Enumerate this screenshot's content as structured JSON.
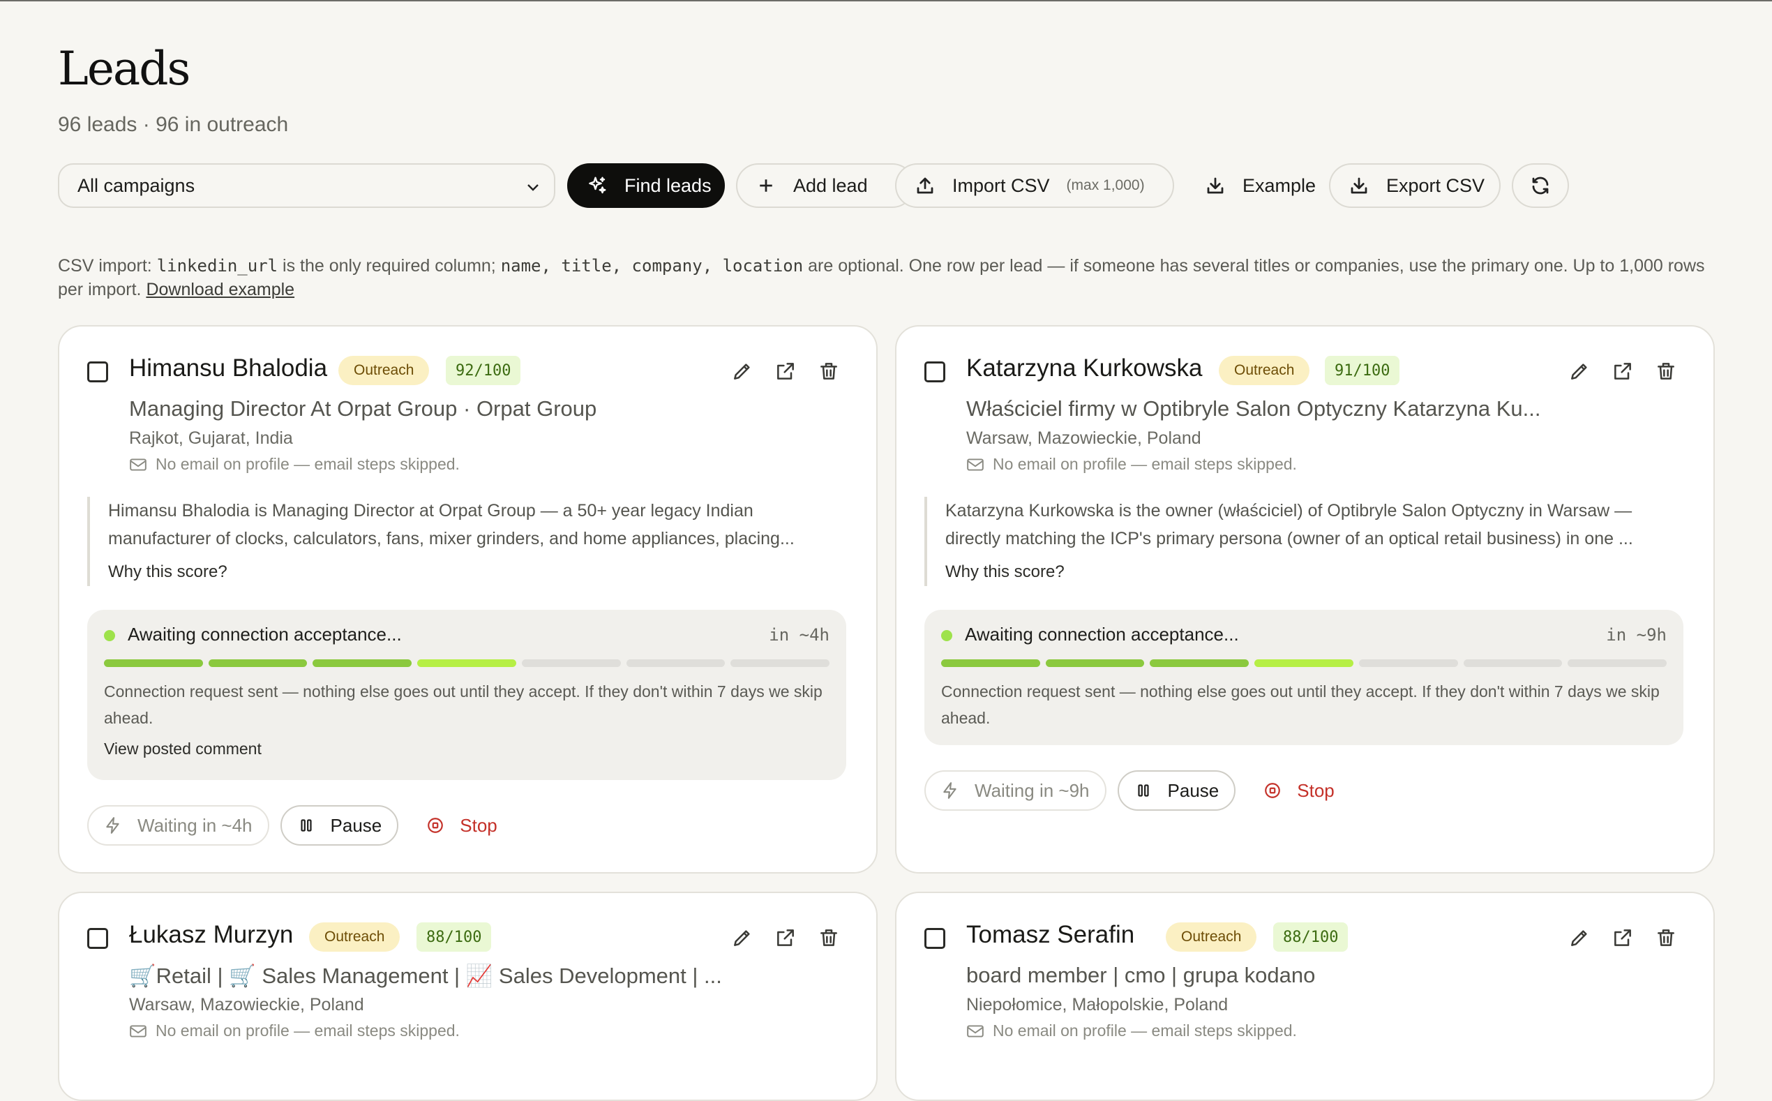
{
  "header": {
    "title": "Leads",
    "subtitle": "96 leads · 96 in outreach"
  },
  "toolbar": {
    "campaign_select": "All campaigns",
    "find_leads": "Find leads",
    "add_lead": "Add lead",
    "import_csv": "Import CSV",
    "import_max": "(max 1,000)",
    "example": "Example",
    "export_csv": "Export CSV"
  },
  "note": {
    "p1": "CSV import: ",
    "c1": "linkedin_url",
    "p2": " is the only required column; ",
    "c2": "name, title, company, location",
    "p3": " are optional. One row per lead — if someone has several titles or companies, use the primary one. Up to 1,000 rows per import. ",
    "link": "Download example"
  },
  "leads": [
    {
      "name": "Himansu Bhalodia",
      "status": "Outreach",
      "score": "92/100",
      "role": "Managing Director At Orpat Group · Orpat Group",
      "location": "Rajkot, Gujarat, India",
      "email_note": "No email on profile — email steps skipped.",
      "summary": "Himansu Bhalodia is Managing Director at Orpat Group — a 50+ year legacy Indian manufacturer of clocks, calculators, fans, mixer grinders, and home appliances, placing...",
      "why": "Why this score?",
      "progress_title": "Awaiting connection acceptance...",
      "eta": "in ~4h",
      "progress_desc": "Connection request sent — nothing else goes out until they accept. If they don't within 7 days we skip ahead.",
      "view_comment": "View posted comment",
      "waiting": "Waiting in ~4h",
      "pause": "Pause",
      "stop": "Stop",
      "steps_done": 3,
      "steps_total": 7
    },
    {
      "name": "Katarzyna Kurkowska",
      "status": "Outreach",
      "score": "91/100",
      "role": "Właściciel firmy w Optibryle Salon Optyczny Katarzyna Ku...",
      "location": "Warsaw, Mazowieckie, Poland",
      "email_note": "No email on profile — email steps skipped.",
      "summary": "Katarzyna Kurkowska is the owner (właściciel) of Optibryle Salon Optyczny in Warsaw — directly matching the ICP's primary persona (owner of an optical retail business) in one ...",
      "why": "Why this score?",
      "progress_title": "Awaiting connection acceptance...",
      "eta": "in ~9h",
      "progress_desc": "Connection request sent — nothing else goes out until they accept. If they don't within 7 days we skip ahead.",
      "waiting": "Waiting in ~9h",
      "pause": "Pause",
      "stop": "Stop",
      "steps_done": 3,
      "steps_total": 7
    },
    {
      "name": "Łukasz Murzyn",
      "status": "Outreach",
      "score": "88/100",
      "role": "🛒Retail | 🛒 Sales Management | 📈 Sales Development | ...",
      "location": "Warsaw, Mazowieckie, Poland",
      "email_note": "No email on profile — email steps skipped."
    },
    {
      "name": "Tomasz Serafin",
      "status": "Outreach",
      "score": "88/100",
      "role": "board member | cmo | grupa kodano",
      "location": "Niepołomice, Małopolskie, Poland",
      "email_note": "No email on profile — email steps skipped."
    }
  ]
}
